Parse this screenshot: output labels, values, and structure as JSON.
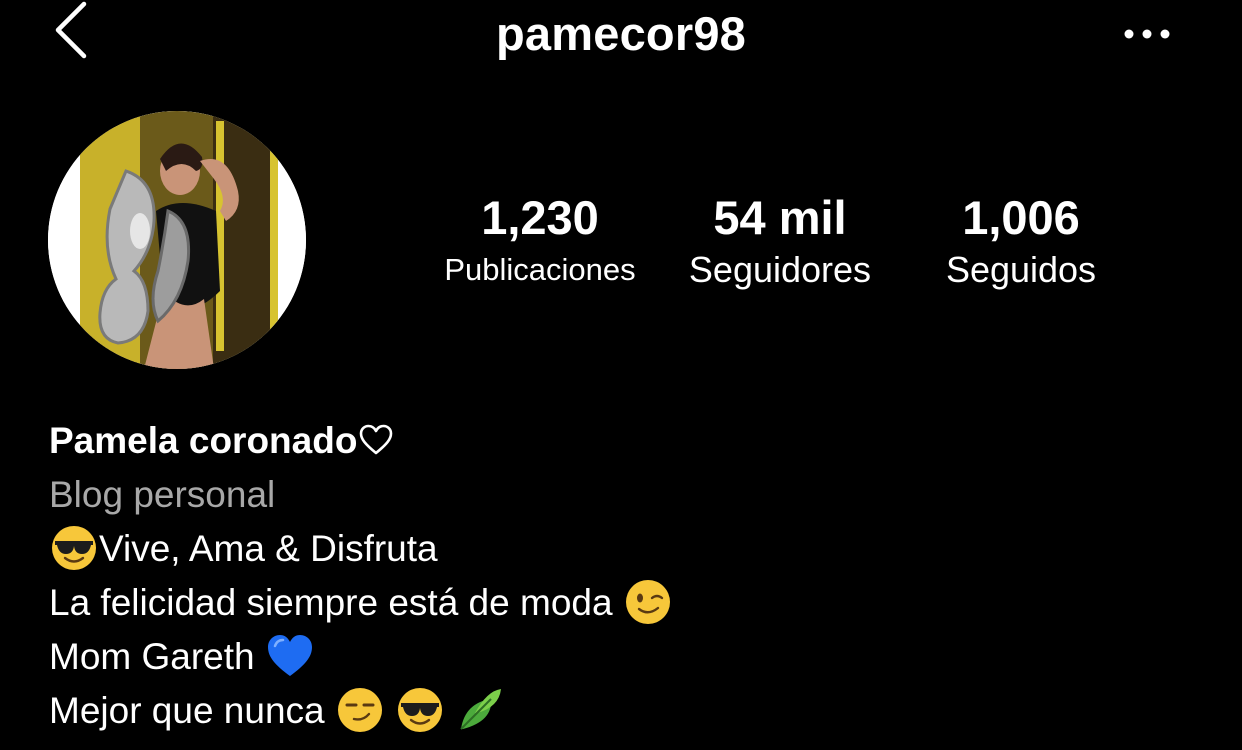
{
  "header": {
    "username": "pamecor98",
    "back_icon": "chevron-left-icon",
    "more_icon": "more-horizontal-icon"
  },
  "profile": {
    "avatar_icon": "profile-photo"
  },
  "stats": {
    "posts": {
      "value": "1,230",
      "label": "Publicaciones"
    },
    "followers": {
      "value": "54 mil",
      "label": "Seguidores"
    },
    "following": {
      "value": "1,006",
      "label": "Seguidos"
    }
  },
  "bio": {
    "name": "Pamela coronado",
    "category": "Blog personal",
    "lines": [
      {
        "text": "Vive, Ama & Disfruta",
        "emoji": "sunglasses-face-emoji"
      },
      {
        "text": "La felicidad siempre está de moda",
        "emoji": "winking-face-emoji"
      },
      {
        "text": "Mom Gareth",
        "emoji": "blue-heart-emoji"
      },
      {
        "text": "Mejor que nunca",
        "emoji": [
          "smirking-face-emoji",
          "sunglasses-face-emoji",
          "leaf-emoji"
        ]
      }
    ]
  },
  "colors": {
    "background": "#000000",
    "text": "#ffffff",
    "secondary_text": "#a8a8a8",
    "emoji_yellow": "#f7c73a",
    "blue_heart": "#1e6cf2"
  }
}
